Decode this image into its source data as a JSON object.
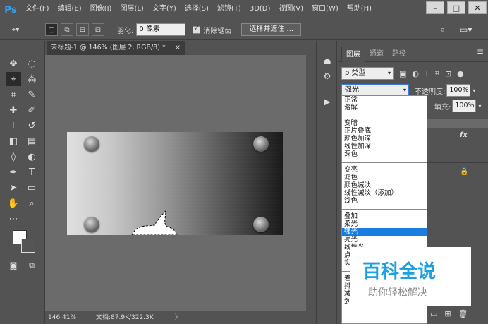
{
  "app": {
    "logo": "Ps"
  },
  "menu": [
    "文件(F)",
    "编辑(E)",
    "图像(I)",
    "图层(L)",
    "文字(Y)",
    "选择(S)",
    "滤镜(T)",
    "3D(D)",
    "视图(V)",
    "窗口(W)",
    "帮助(H)"
  ],
  "window_controls": {
    "minimize": "–",
    "maximize": "□",
    "close": "✕"
  },
  "options": {
    "feather_label": "羽化:",
    "feather_value": "0 像素",
    "antialias_label": "消除锯齿",
    "select_mask_button": "选择并遮住 ..."
  },
  "document": {
    "tab_title": "未标题-1 @ 146% (图层 2, RGB/8) *",
    "close": "×",
    "zoom": "146.41%",
    "info": "文档:87.9K/322.3K",
    "arrow": "〉"
  },
  "layers_panel": {
    "tabs": [
      "图层",
      "通道",
      "路径"
    ],
    "menu_icon": "≡",
    "filter_label": "ρ 类型",
    "blend_mode": "强光",
    "opacity_label": "不透明度:",
    "opacity_value": "100%",
    "fill_label": "填充:",
    "fill_value": "100%",
    "fx": "fx"
  },
  "blend_dropdown": {
    "groups": [
      [
        "正常",
        "溶解"
      ],
      [
        "变暗",
        "正片叠底",
        "颜色加深",
        "线性加深",
        "深色"
      ],
      [
        "变亮",
        "滤色",
        "颜色减淡",
        "线性减淡（添加）",
        "浅色"
      ],
      [
        "叠加",
        "柔光",
        "强光",
        "亮光",
        "线性光",
        "点光",
        "实色混合"
      ],
      [
        "差值",
        "排除",
        "减去",
        "划分"
      ]
    ],
    "selected": "强光"
  },
  "watermark": {
    "title": "百科全说",
    "subtitle": "助你轻松解决"
  },
  "colors": {
    "accent": "#1a7ee0",
    "ps_blue": "#31a8ff",
    "watermark_blue": "#1aa1e0"
  }
}
